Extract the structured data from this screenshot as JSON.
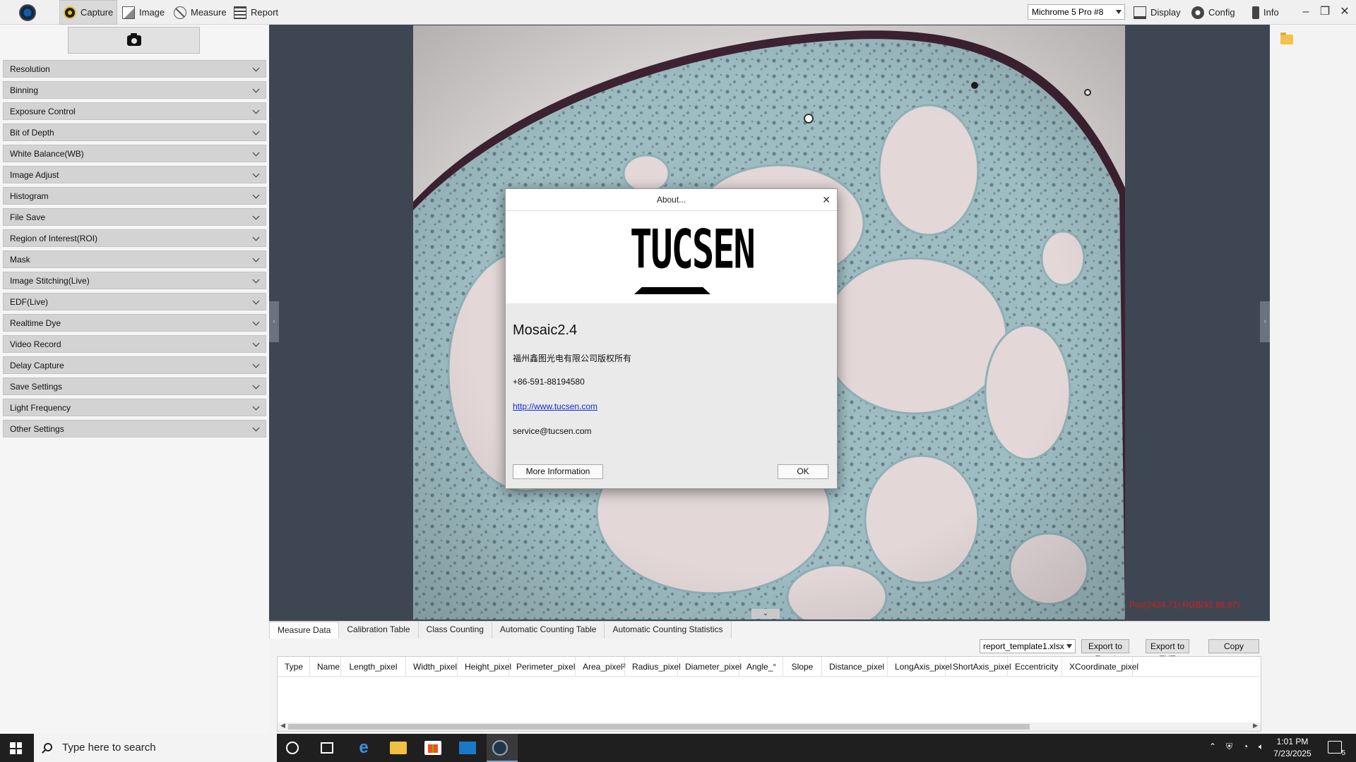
{
  "toolbar": {
    "tabs": [
      {
        "label": "Capture",
        "icon": "capture-icon",
        "active": true
      },
      {
        "label": "Image",
        "icon": "image-icon"
      },
      {
        "label": "Measure",
        "icon": "measure-icon"
      },
      {
        "label": "Report",
        "icon": "report-icon"
      }
    ],
    "camera_select": "Michrome 5 Pro #8",
    "display_label": "Display",
    "config_label": "Config",
    "info_label": "Info"
  },
  "left_panel": {
    "sections": [
      "Resolution",
      "Binning",
      "Exposure Control",
      "Bit of Depth",
      "White Balance(WB)",
      "Image Adjust",
      "Histogram",
      "File Save",
      "Region of Interest(ROI)",
      "Mask",
      "Image Stitching(Live)",
      "EDF(Live)",
      "Realtime Dye",
      "Video Record",
      "Delay Capture",
      "Save Settings",
      "Light Frequency",
      "Other Settings"
    ]
  },
  "viewer": {
    "position_readout": "Pos(2424,71) RGB(92,88,87)"
  },
  "data_panel": {
    "tabs": [
      "Measure Data",
      "Calibration Table",
      "Class Counting",
      "Automatic Counting Table",
      "Automatic Counting Statistics"
    ],
    "active_tab": "Measure Data",
    "report_template": "report_template1.xlsx",
    "buttons": {
      "excel": "Export to Excel",
      "txt": "Export to TXT",
      "copy": "Copy"
    },
    "columns": [
      "Type",
      "Name",
      "Length_pixel",
      "Width_pixel",
      "Height_pixel",
      "Perimeter_pixel",
      "Area_pixel²",
      "Radius_pixel",
      "Diameter_pixel",
      "Angle_°",
      "Slope",
      "Distance_pixel",
      "LongAxis_pixel",
      "ShortAxis_pixel",
      "Eccentricity",
      "XCoordinate_pixel"
    ]
  },
  "about_dialog": {
    "title": "About...",
    "logo_text": "TUCSEN",
    "app_name": "Mosaic2.4",
    "copyright": "福州鑫图光电有限公司版权所有",
    "phone": "+86-591-88194580",
    "website": "http://www.tucsen.com",
    "email": "service@tucsen.com",
    "more_info_label": "More Information",
    "ok_label": "OK"
  },
  "taskbar": {
    "search_placeholder": "Type here to search",
    "time": "1:01 PM",
    "date": "7/23/2025",
    "notification_count": "5"
  },
  "colors": {
    "viewer_bg": "#3f4653",
    "readout": "#d21e1e",
    "link": "#0b2ccf",
    "capture_accent": "#e1c12d"
  }
}
